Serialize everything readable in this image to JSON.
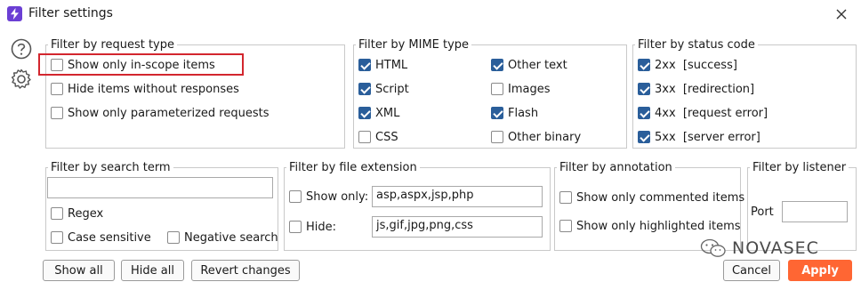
{
  "window": {
    "title": "Filter settings"
  },
  "request_type": {
    "legend": "Filter by request type",
    "items": [
      {
        "label": "Show only in-scope items",
        "checked": false
      },
      {
        "label": "Hide items without responses",
        "checked": false
      },
      {
        "label": "Show only parameterized requests",
        "checked": false
      }
    ]
  },
  "mime": {
    "legend": "Filter by MIME type",
    "col1": [
      {
        "label": "HTML",
        "checked": true
      },
      {
        "label": "Script",
        "checked": true
      },
      {
        "label": "XML",
        "checked": true
      },
      {
        "label": "CSS",
        "checked": false
      }
    ],
    "col2": [
      {
        "label": "Other text",
        "checked": true
      },
      {
        "label": "Images",
        "checked": false
      },
      {
        "label": "Flash",
        "checked": true
      },
      {
        "label": "Other binary",
        "checked": false
      }
    ]
  },
  "status": {
    "legend": "Filter by status code",
    "items": [
      {
        "label": "2xx  [success]",
        "checked": true
      },
      {
        "label": "3xx  [redirection]",
        "checked": true
      },
      {
        "label": "4xx  [request error]",
        "checked": true
      },
      {
        "label": "5xx  [server error]",
        "checked": true
      }
    ]
  },
  "search": {
    "legend": "Filter by search term",
    "value": "",
    "regex": "Regex",
    "case": "Case sensitive",
    "negative": "Negative search"
  },
  "extension": {
    "legend": "Filter by file extension",
    "show_label": "Show only:",
    "show_value": "asp,aspx,jsp,php",
    "hide_label": "Hide:",
    "hide_value": "js,gif,jpg,png,css"
  },
  "annotation": {
    "legend": "Filter by annotation",
    "commented": "Show only commented items",
    "highlighted": "Show only highlighted items"
  },
  "listener": {
    "legend": "Filter by listener",
    "port_label": "Port",
    "port_value": ""
  },
  "buttons": {
    "show_all": "Show all",
    "hide_all": "Hide all",
    "revert": "Revert changes",
    "cancel": "Cancel",
    "apply": "Apply"
  },
  "watermark": {
    "text": "NOVASEC"
  },
  "colors": {
    "accent": "#ff6633",
    "checkbox": "#2a5e9a",
    "annotation_box": "#d3262e",
    "app_icon": "#6b3fd4"
  }
}
